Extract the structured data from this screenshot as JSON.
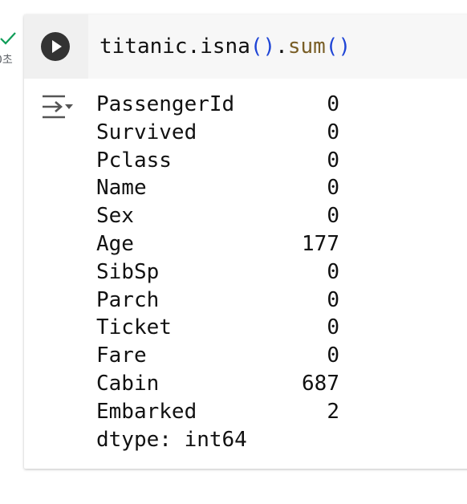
{
  "cell_status": {
    "time_label": "0초",
    "check_color": "#0f9d58",
    "check_icon": "check-icon"
  },
  "cell": {
    "run_icon": "play-icon",
    "code": {
      "object": "titanic",
      "dot1": ".",
      "method1": "isna",
      "paren_open1": "(",
      "paren_close1": ")",
      "dot2": ".",
      "method2": "sum",
      "paren_open2": "(",
      "paren_close2": ")"
    },
    "output": {
      "toggle_icon": "output-collapse-icon",
      "rows": [
        {
          "column": "PassengerId",
          "count": "0"
        },
        {
          "column": "Survived",
          "count": "0"
        },
        {
          "column": "Pclass",
          "count": "0"
        },
        {
          "column": "Name",
          "count": "0"
        },
        {
          "column": "Sex",
          "count": "0"
        },
        {
          "column": "Age",
          "count": "177"
        },
        {
          "column": "SibSp",
          "count": "0"
        },
        {
          "column": "Parch",
          "count": "0"
        },
        {
          "column": "Ticket",
          "count": "0"
        },
        {
          "column": "Fare",
          "count": "0"
        },
        {
          "column": "Cabin",
          "count": "687"
        },
        {
          "column": "Embarked",
          "count": "2"
        }
      ],
      "dtype": "dtype: int64"
    }
  }
}
